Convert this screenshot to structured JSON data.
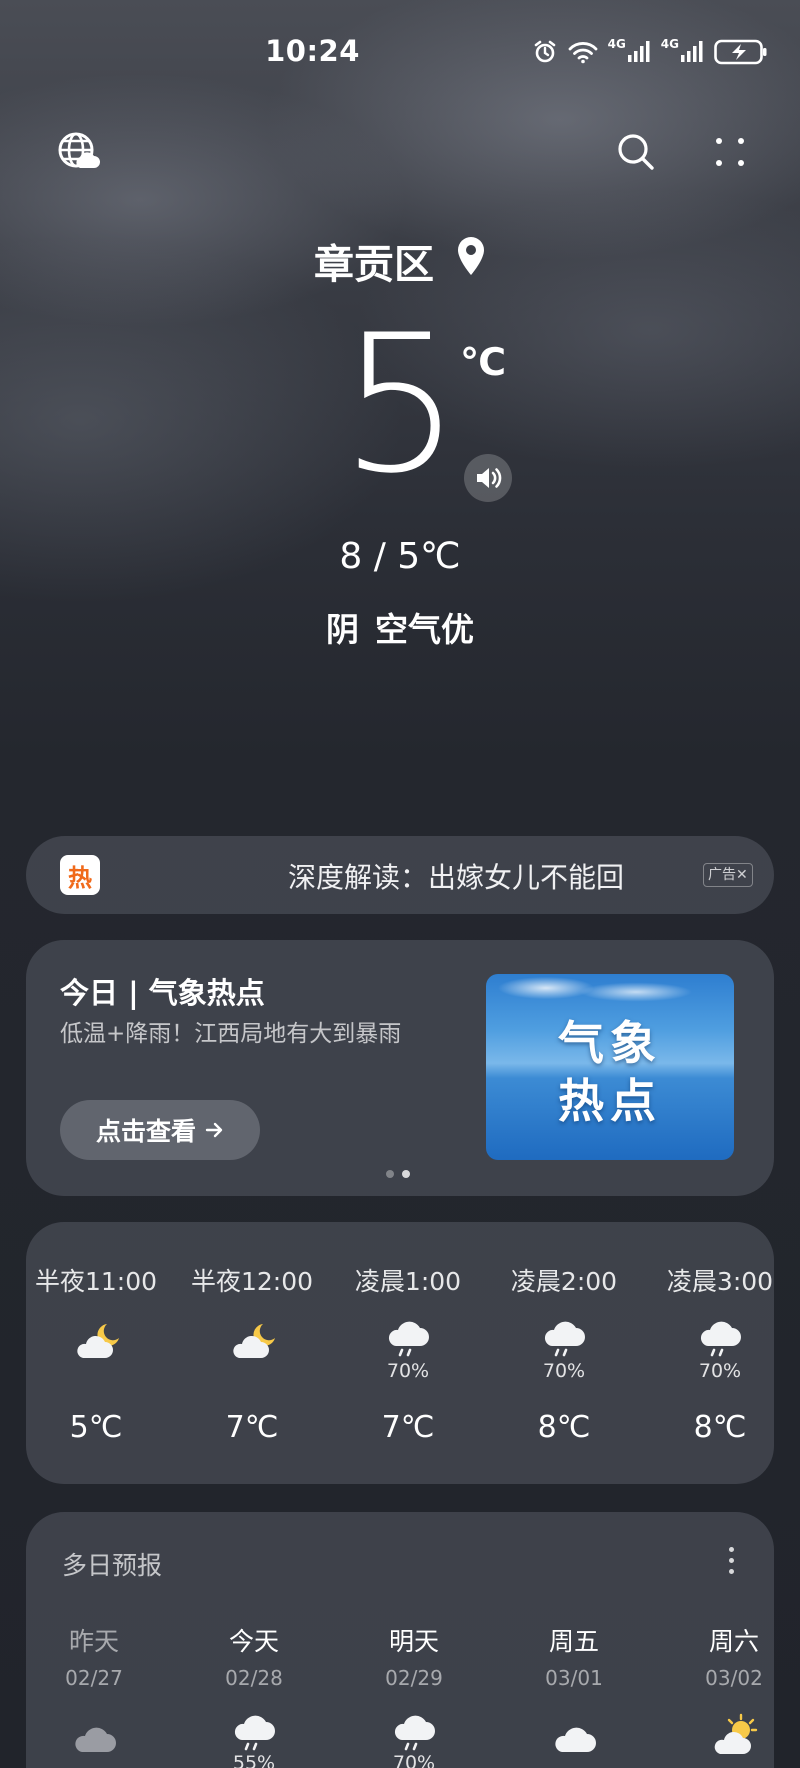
{
  "status_bar": {
    "time": "10:24",
    "icons": [
      "alarm-icon",
      "wifi-icon",
      "signal-4g-icon",
      "signal-4g-icon",
      "battery-charging-icon"
    ],
    "network_label_1": "4G",
    "network_label_2": "4G"
  },
  "top_bar": {
    "left_icon": "globe-cloud-icon",
    "right_icons": [
      "search-icon",
      "more-dots-icon"
    ]
  },
  "current": {
    "location": "章贡区",
    "temperature": "5",
    "unit": "℃",
    "range": "8 / 5℃",
    "condition": "阴",
    "air_quality": "空气优"
  },
  "ad_banner": {
    "badge": "热",
    "text": "深度解读：出嫁女儿不能回",
    "tag": "广告✕"
  },
  "news_card": {
    "title": "今日 | 气象热点",
    "subtitle": "低温+降雨！江西局地有大到暴雨",
    "button_label": "点击查看",
    "image_text_line1": "气象",
    "image_text_line2": "热点",
    "page_count": 2,
    "active_page": 2
  },
  "hourly": [
    {
      "time": "半夜11:00",
      "icon": "moon-cloud-icon",
      "pop": "",
      "temp": "5℃"
    },
    {
      "time": "半夜12:00",
      "icon": "moon-cloud-icon",
      "pop": "",
      "temp": "7℃"
    },
    {
      "time": "凌晨1:00",
      "icon": "rain-cloud-icon",
      "pop": "70%",
      "temp": "7℃"
    },
    {
      "time": "凌晨2:00",
      "icon": "rain-cloud-icon",
      "pop": "70%",
      "temp": "8℃"
    },
    {
      "time": "凌晨3:00",
      "icon": "rain-cloud-icon",
      "pop": "70%",
      "temp": "8℃"
    }
  ],
  "daily": {
    "title": "多日预报",
    "days": [
      {
        "name": "昨天",
        "date": "02/27",
        "icon": "cloud-icon",
        "pop": ""
      },
      {
        "name": "今天",
        "date": "02/28",
        "icon": "rain-cloud-icon",
        "pop": "55%"
      },
      {
        "name": "明天",
        "date": "02/29",
        "icon": "rain-cloud-icon",
        "pop": "70%"
      },
      {
        "name": "周五",
        "date": "03/01",
        "icon": "cloud-icon",
        "pop": ""
      },
      {
        "name": "周六",
        "date": "03/02",
        "icon": "sun-cloud-icon",
        "pop": ""
      }
    ]
  },
  "colors": {
    "hot_badge": "#f06a1b",
    "moon": "#f7c948",
    "sun": "#f7c948"
  }
}
